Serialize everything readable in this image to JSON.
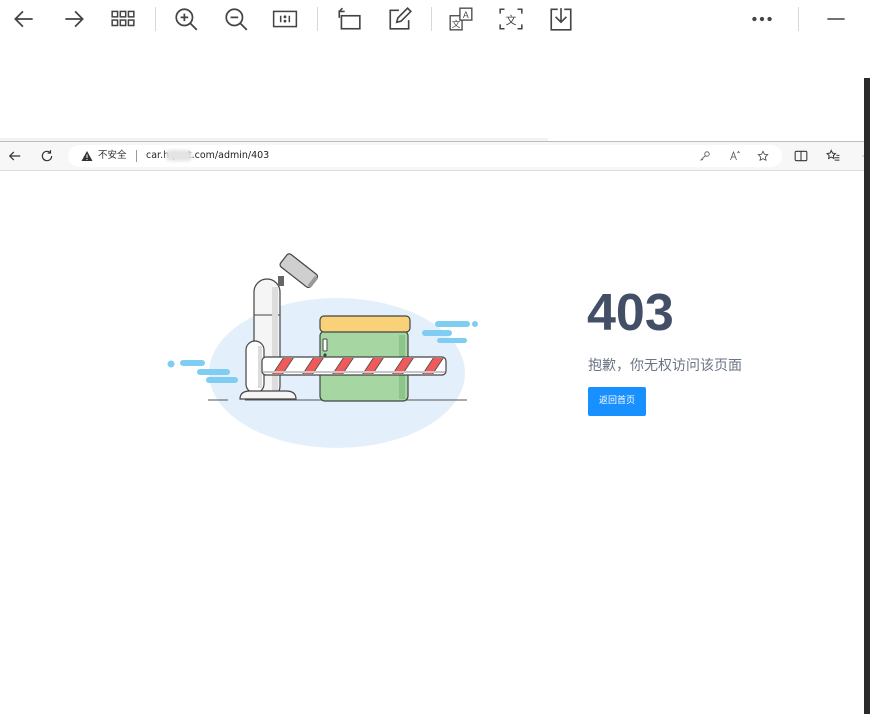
{
  "viewer": {
    "tools": [
      "back-icon",
      "forward-icon",
      "grid-icon",
      "zoom-in-icon",
      "zoom-out-icon",
      "actual-size-icon",
      "rotate-icon",
      "edit-icon",
      "translate-image-icon",
      "ocr-text-icon",
      "download-icon",
      "more-icon",
      "minimize-icon"
    ]
  },
  "browser": {
    "security_label": "不安全",
    "url": "car.h          port.com/admin/403"
  },
  "error_page": {
    "code": "403",
    "message": "抱歉，你无权访问该页面",
    "home_button": "返回首页"
  },
  "colors": {
    "accent": "#1890ff",
    "code_text": "#434f66",
    "message_text": "#6c7585",
    "box_green": "#a6d7a3",
    "box_lid": "#f9d178",
    "barrier_red": "#f15a5a",
    "ellipse_bg": "#e3f0fb",
    "cloud_blue": "#7fcdf3"
  }
}
